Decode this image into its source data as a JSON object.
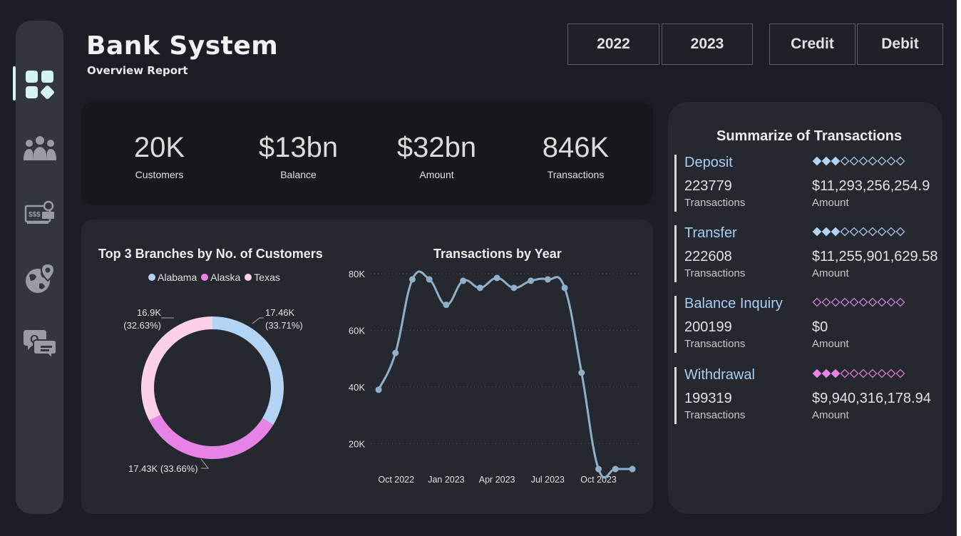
{
  "app": {
    "title": "Bank System",
    "subtitle": "Overview Report"
  },
  "nav": {
    "items": [
      {
        "icon": "dashboard-icon",
        "active": true
      },
      {
        "icon": "customers-icon",
        "active": false
      },
      {
        "icon": "payment-terminal-icon",
        "active": false
      },
      {
        "icon": "globe-location-icon",
        "active": false
      },
      {
        "icon": "qa-chat-icon",
        "active": false
      }
    ]
  },
  "filters": {
    "years": [
      "2022",
      "2023"
    ],
    "types": [
      "Credit",
      "Debit"
    ]
  },
  "kpis": [
    {
      "value": "20K",
      "label": "Customers"
    },
    {
      "value": "$13bn",
      "label": "Balance"
    },
    {
      "value": "$32bn",
      "label": "Amount"
    },
    {
      "value": "846K",
      "label": "Transactions"
    }
  ],
  "colors": {
    "alabama": "#b3d4f5",
    "alaska": "#e783e6",
    "texas": "#fdd0ea",
    "line": "#8fb0c8",
    "accent": "#d4f3f2"
  },
  "chart_data": [
    {
      "type": "pie",
      "title": "Top 3 Branches by No. of Customers",
      "legend_position": "top",
      "categories": [
        "Alabama",
        "Alaska",
        "Texas"
      ],
      "values": [
        17.46,
        17.43,
        16.9
      ],
      "percents": [
        33.71,
        33.66,
        32.63
      ],
      "labels": [
        "17.46K\n(33.71%)",
        "17.43K (33.66%)",
        "16.9K\n(32.63%)"
      ]
    },
    {
      "type": "line",
      "title": "Transactions by Year",
      "x": [
        "2022-09",
        "2022-10",
        "2022-11",
        "2022-12",
        "2023-01",
        "2023-02",
        "2023-03",
        "2023-04",
        "2023-05",
        "2023-06",
        "2023-07",
        "2023-08",
        "2023-09",
        "2023-10",
        "2023-11",
        "2023-12"
      ],
      "values": [
        39000,
        52000,
        78000,
        78000,
        69000,
        77500,
        75000,
        78500,
        75000,
        77500,
        78000,
        75000,
        45000,
        11000,
        11000,
        11000
      ],
      "xtick_labels": [
        "Oct 2022",
        "Jan 2023",
        "Apr 2023",
        "Jul 2023",
        "Oct 2023"
      ],
      "ytick_labels": [
        "20K",
        "40K",
        "60K",
        "80K"
      ],
      "ylim": [
        10000,
        80000
      ],
      "grid": true
    }
  ],
  "summary": {
    "title": "Summarize of Transactions",
    "items": [
      {
        "name": "Deposit",
        "count": "223779",
        "count_label": "Transactions",
        "amount": "$11,293,256,254.9",
        "amount_label": "Amount",
        "rating": 3,
        "rating_color": "#b3d4f5"
      },
      {
        "name": "Transfer",
        "count": "222608",
        "count_label": "Transactions",
        "amount": "$11,255,901,629.58",
        "amount_label": "Amount",
        "rating": 3,
        "rating_color": "#b3d4f5"
      },
      {
        "name": "Balance Inquiry",
        "count": "200199",
        "count_label": "Transactions",
        "amount": "$0",
        "amount_label": "Amount",
        "rating": 0,
        "rating_color": "#e783e6"
      },
      {
        "name": "Withdrawal",
        "count": "199319",
        "count_label": "Transactions",
        "amount": "$9,940,316,178.94",
        "amount_label": "Amount",
        "rating": 3,
        "rating_color": "#e783e6"
      }
    ]
  }
}
